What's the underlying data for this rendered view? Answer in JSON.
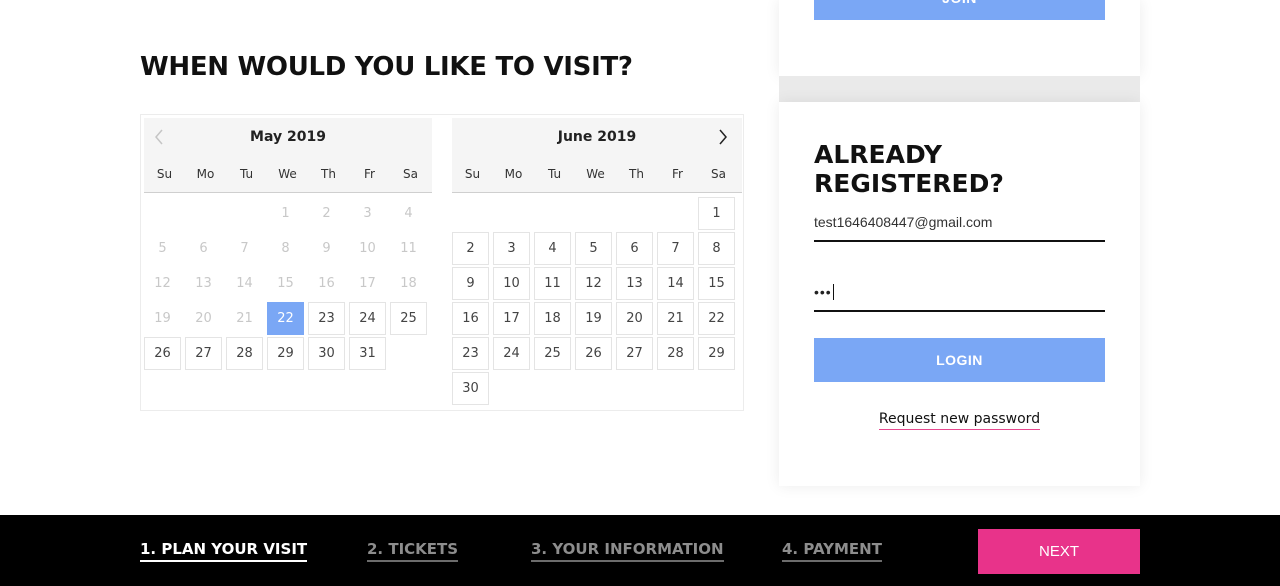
{
  "heading": "WHEN WOULD YOU LIKE TO VISIT?",
  "calendar": {
    "weekdays": [
      "Su",
      "Mo",
      "Tu",
      "We",
      "Th",
      "Fr",
      "Sa"
    ],
    "months": [
      {
        "title": "May 2019",
        "leading_blank": 3,
        "days": [
          {
            "n": "1",
            "state": "disabled"
          },
          {
            "n": "2",
            "state": "disabled"
          },
          {
            "n": "3",
            "state": "disabled"
          },
          {
            "n": "4",
            "state": "disabled"
          },
          {
            "n": "5",
            "state": "disabled"
          },
          {
            "n": "6",
            "state": "disabled"
          },
          {
            "n": "7",
            "state": "disabled"
          },
          {
            "n": "8",
            "state": "disabled"
          },
          {
            "n": "9",
            "state": "disabled"
          },
          {
            "n": "10",
            "state": "disabled"
          },
          {
            "n": "11",
            "state": "disabled"
          },
          {
            "n": "12",
            "state": "disabled"
          },
          {
            "n": "13",
            "state": "disabled"
          },
          {
            "n": "14",
            "state": "disabled"
          },
          {
            "n": "15",
            "state": "disabled"
          },
          {
            "n": "16",
            "state": "disabled"
          },
          {
            "n": "17",
            "state": "disabled"
          },
          {
            "n": "18",
            "state": "disabled"
          },
          {
            "n": "19",
            "state": "disabled"
          },
          {
            "n": "20",
            "state": "disabled"
          },
          {
            "n": "21",
            "state": "disabled"
          },
          {
            "n": "22",
            "state": "selected"
          },
          {
            "n": "23",
            "state": "enabled"
          },
          {
            "n": "24",
            "state": "enabled"
          },
          {
            "n": "25",
            "state": "enabled"
          },
          {
            "n": "26",
            "state": "enabled"
          },
          {
            "n": "27",
            "state": "enabled"
          },
          {
            "n": "28",
            "state": "enabled"
          },
          {
            "n": "29",
            "state": "enabled"
          },
          {
            "n": "30",
            "state": "enabled"
          },
          {
            "n": "31",
            "state": "enabled"
          }
        ]
      },
      {
        "title": "June 2019",
        "leading_blank": 6,
        "days": [
          {
            "n": "1",
            "state": "enabled"
          },
          {
            "n": "2",
            "state": "enabled"
          },
          {
            "n": "3",
            "state": "enabled"
          },
          {
            "n": "4",
            "state": "enabled"
          },
          {
            "n": "5",
            "state": "enabled"
          },
          {
            "n": "6",
            "state": "enabled"
          },
          {
            "n": "7",
            "state": "enabled"
          },
          {
            "n": "8",
            "state": "enabled"
          },
          {
            "n": "9",
            "state": "enabled"
          },
          {
            "n": "10",
            "state": "enabled"
          },
          {
            "n": "11",
            "state": "enabled"
          },
          {
            "n": "12",
            "state": "enabled"
          },
          {
            "n": "13",
            "state": "enabled"
          },
          {
            "n": "14",
            "state": "enabled"
          },
          {
            "n": "15",
            "state": "enabled"
          },
          {
            "n": "16",
            "state": "enabled"
          },
          {
            "n": "17",
            "state": "enabled"
          },
          {
            "n": "18",
            "state": "enabled"
          },
          {
            "n": "19",
            "state": "enabled"
          },
          {
            "n": "20",
            "state": "enabled"
          },
          {
            "n": "21",
            "state": "enabled"
          },
          {
            "n": "22",
            "state": "enabled"
          },
          {
            "n": "23",
            "state": "enabled"
          },
          {
            "n": "24",
            "state": "enabled"
          },
          {
            "n": "25",
            "state": "enabled"
          },
          {
            "n": "26",
            "state": "enabled"
          },
          {
            "n": "27",
            "state": "enabled"
          },
          {
            "n": "28",
            "state": "enabled"
          },
          {
            "n": "29",
            "state": "enabled"
          },
          {
            "n": "30",
            "state": "enabled"
          }
        ]
      }
    ],
    "prev_icon": "chevron-left-icon",
    "next_icon": "chevron-right-icon",
    "selected_color": "#7aa7f5"
  },
  "register_card": {
    "join_label": "JOIN"
  },
  "login": {
    "title": "ALREADY REGISTERED?",
    "email_value": "test1646408447@gmail.com",
    "password_mask": "•••",
    "login_label": "LOGIN",
    "request_password": "Request new password",
    "accent": "#7aa7f5"
  },
  "footer": {
    "steps": [
      {
        "label": "1. PLAN YOUR VISIT",
        "active": true
      },
      {
        "label": "2. TICKETS",
        "active": false
      },
      {
        "label": "3. YOUR INFORMATION",
        "active": false
      },
      {
        "label": "4. PAYMENT",
        "active": false
      }
    ],
    "next_label": "NEXT",
    "next_color": "#e8338a"
  }
}
